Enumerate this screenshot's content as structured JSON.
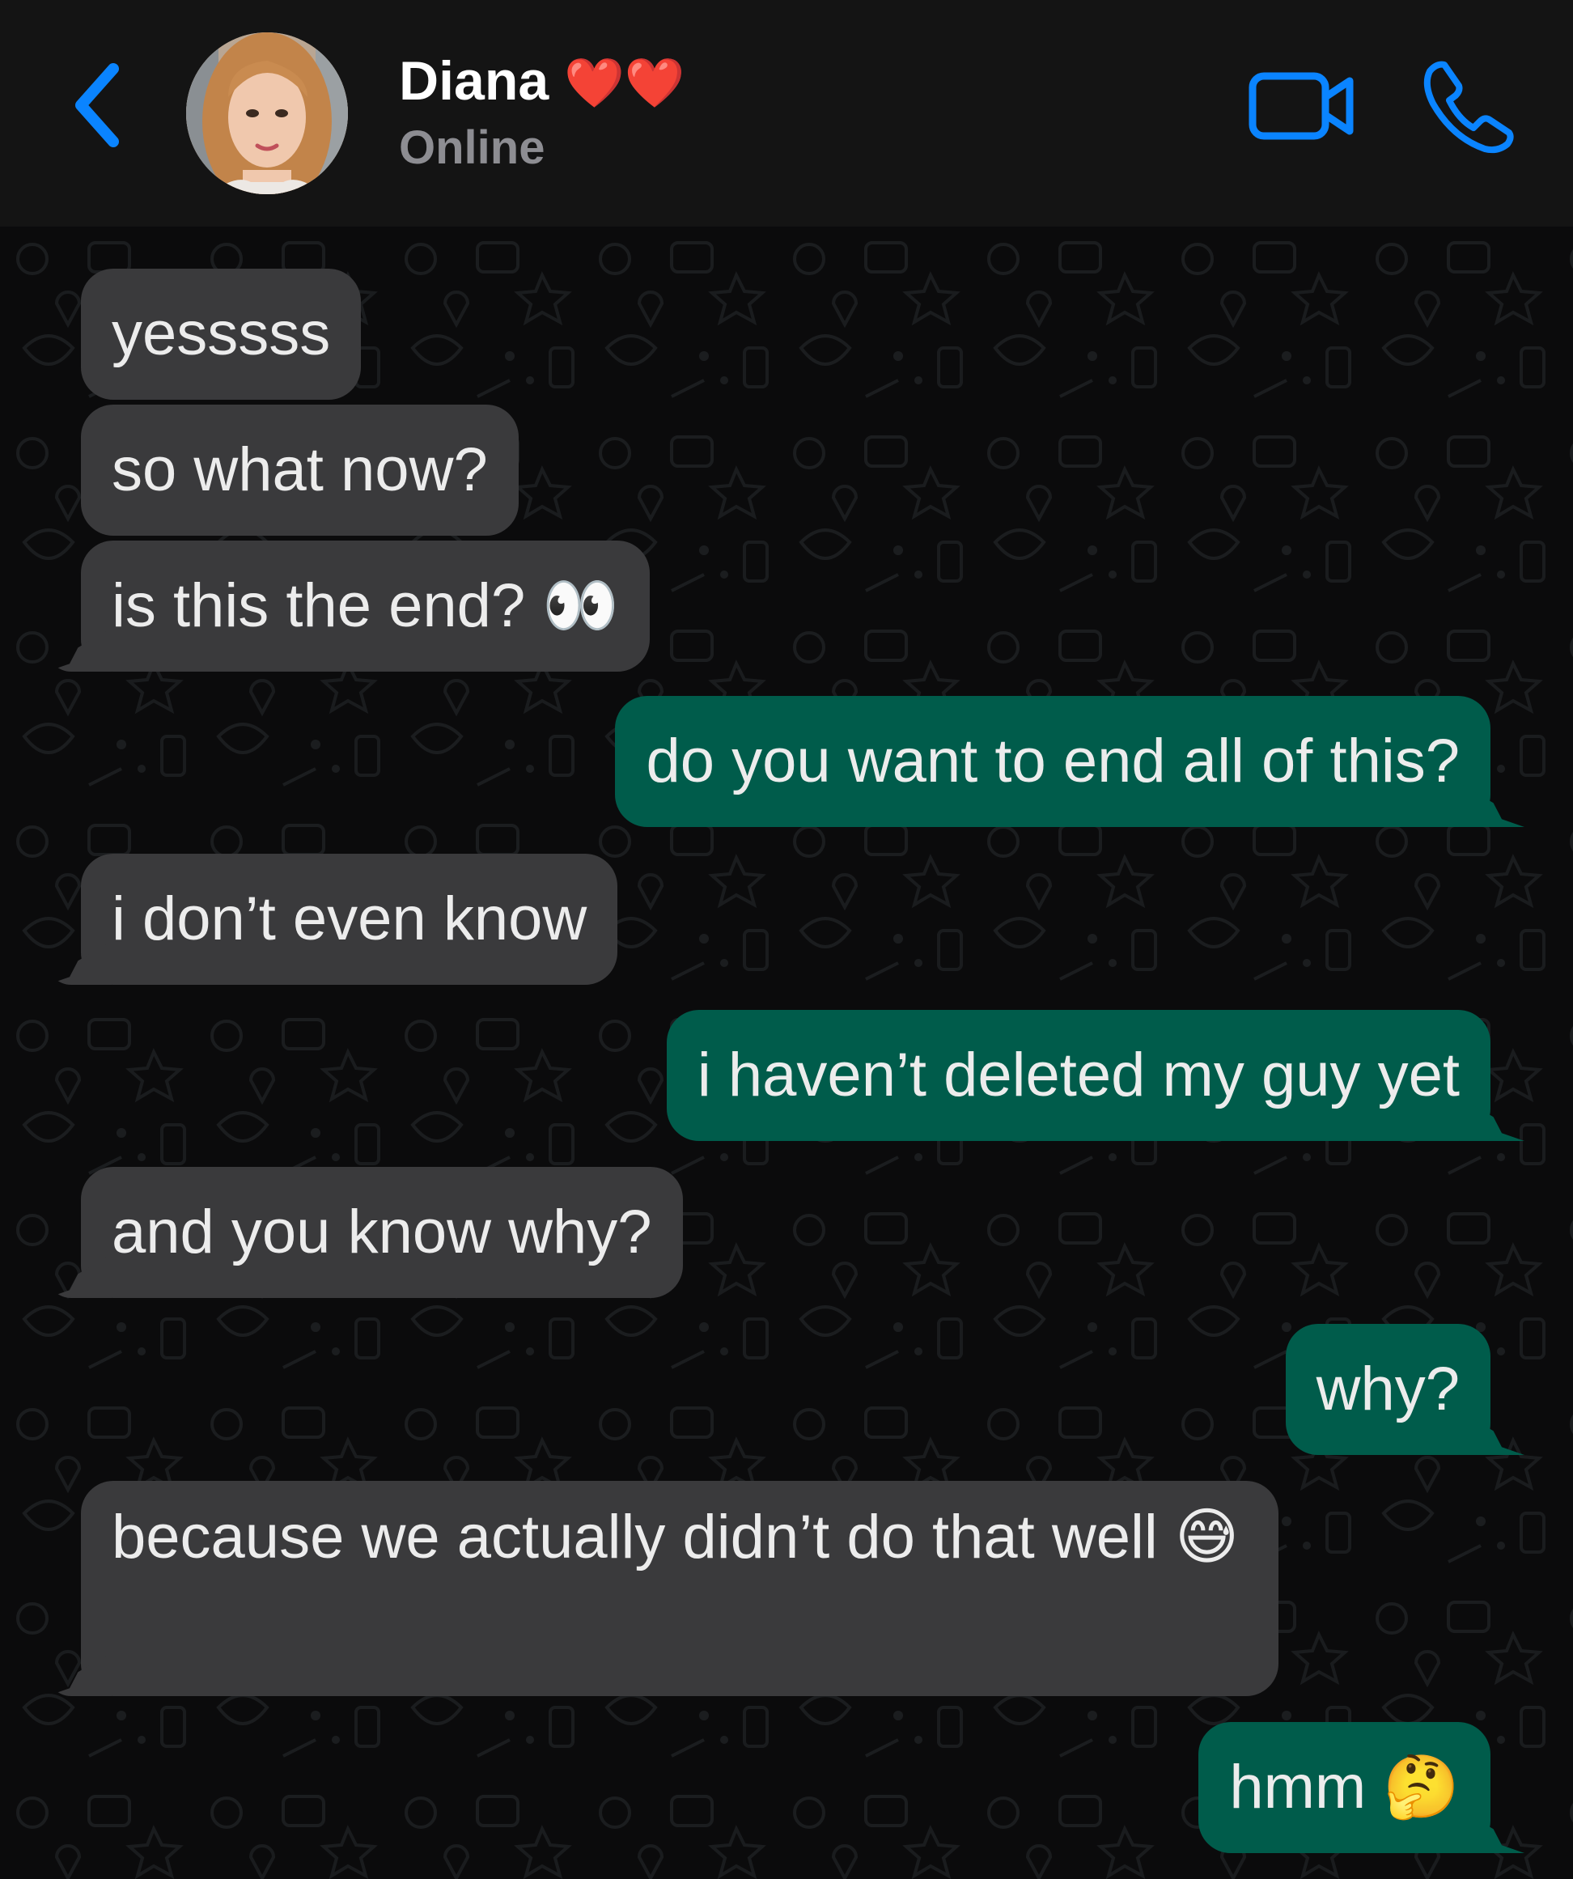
{
  "header": {
    "contact_name": "Diana",
    "name_emoji": "❤️❤️",
    "status": "Online",
    "back_icon": "chevron-left-icon",
    "video_icon": "video-camera-icon",
    "call_icon": "phone-icon"
  },
  "colors": {
    "accent": "#0a84ff",
    "incoming_bubble": "#3a3a3c",
    "outgoing_bubble": "#005c4b",
    "header_bg": "#141414",
    "chat_bg": "#0b0b0c"
  },
  "messages": [
    {
      "direction": "incoming",
      "text": "yesssss"
    },
    {
      "direction": "incoming",
      "text": "so what now?"
    },
    {
      "direction": "incoming",
      "text": "is this the end? 👀"
    },
    {
      "direction": "outgoing",
      "text": "do you want to end all of this?"
    },
    {
      "direction": "incoming",
      "text": "i don’t even know"
    },
    {
      "direction": "outgoing",
      "text": "i haven’t deleted my guy yet"
    },
    {
      "direction": "incoming",
      "text": "and you know why?"
    },
    {
      "direction": "outgoing",
      "text": "why?"
    },
    {
      "direction": "incoming",
      "text": "because we actually didn’t do that well 😅"
    },
    {
      "direction": "outgoing",
      "text": "hmm 🤔"
    }
  ]
}
